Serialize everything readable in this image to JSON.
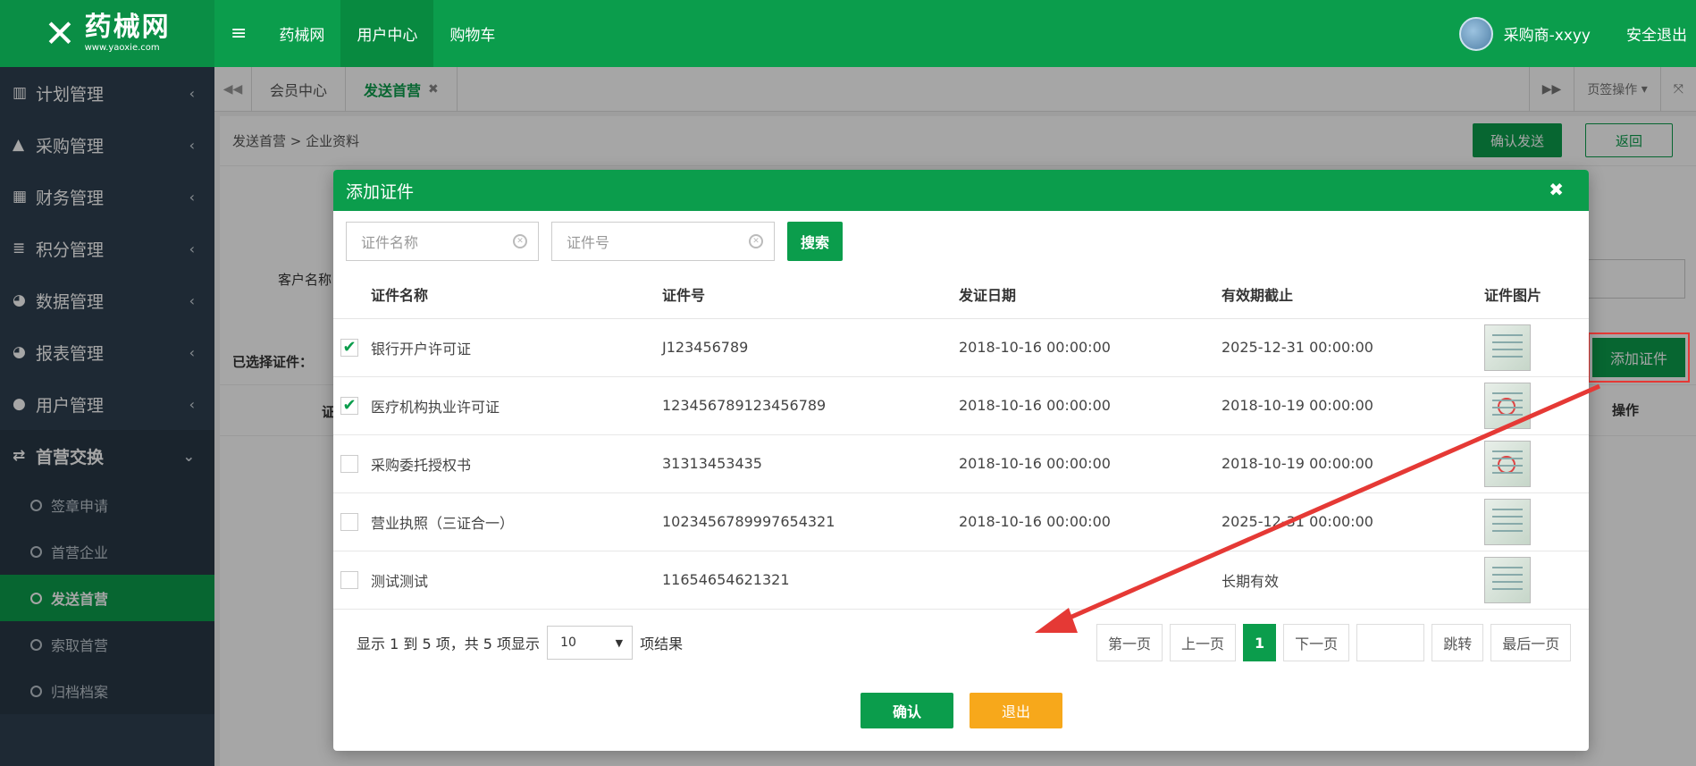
{
  "brand": {
    "logo_text": "药械网",
    "logo_sub": "www.yaoxie.com"
  },
  "topnav": {
    "items": [
      "药械网",
      "用户中心",
      "购物车"
    ]
  },
  "user": {
    "name": "采购商-xxyy",
    "logout": "安全退出"
  },
  "sidebar": {
    "items": [
      {
        "label": "计划管理"
      },
      {
        "label": "采购管理"
      },
      {
        "label": "财务管理"
      },
      {
        "label": "积分管理"
      },
      {
        "label": "数据管理"
      },
      {
        "label": "报表管理"
      },
      {
        "label": "用户管理"
      },
      {
        "label": "首营交换"
      }
    ],
    "subitems": [
      {
        "label": "签章申请"
      },
      {
        "label": "首营企业"
      },
      {
        "label": "发送首营"
      },
      {
        "label": "索取首营"
      },
      {
        "label": "归档档案"
      }
    ]
  },
  "tabs": {
    "items": [
      "会员中心",
      "发送首营"
    ],
    "page_ops": "页签操作"
  },
  "content": {
    "breadcrumb": "发送首营 > 企业资料",
    "confirm_send": "确认发送",
    "back": "返回",
    "customer_label": "客户名称",
    "selected_label": "已选择证件：",
    "col_left": "证",
    "col_op": "操作",
    "add_cert": "添加证件"
  },
  "modal": {
    "title": "添加证件",
    "search": {
      "name_placeholder": "证件名称",
      "no_placeholder": "证件号",
      "button": "搜索"
    },
    "columns": [
      "证件名称",
      "证件号",
      "发证日期",
      "有效期截止",
      "证件图片"
    ],
    "rows": [
      {
        "checked": true,
        "name": "银行开户许可证",
        "no": "J123456789",
        "date": "2018-10-16 00:00:00",
        "expiry": "2025-12-31 00:00:00"
      },
      {
        "checked": true,
        "name": "医疗机构执业许可证",
        "no": "123456789123456789",
        "date": "2018-10-16 00:00:00",
        "expiry": "2018-10-19 00:00:00"
      },
      {
        "checked": false,
        "name": "采购委托授权书",
        "no": "31313453435",
        "date": "2018-10-16 00:00:00",
        "expiry": "2018-10-19 00:00:00"
      },
      {
        "checked": false,
        "name": "营业执照（三证合一）",
        "no": "102345678999765​4321",
        "date": "2018-10-16 00:00:00",
        "expiry": "2025-12-31 00:00:00"
      },
      {
        "checked": false,
        "name": "测试测试",
        "no": "11654654621321",
        "date": "",
        "expiry": "长期有效"
      }
    ],
    "info_prefix": "显示 1 到 5 项，共 5 项显示",
    "page_size": "10",
    "info_suffix": "项结果",
    "pager": {
      "first": "第一页",
      "prev": "上一页",
      "current": "1",
      "next": "下一页",
      "jump": "跳转",
      "last": "最后一页"
    },
    "ok": "确认",
    "exit": "退出"
  },
  "colors": {
    "brand": "#0b9d4c",
    "sidebar": "#2f4050",
    "warn": "#f7a81b",
    "annotation": "#e53935"
  }
}
